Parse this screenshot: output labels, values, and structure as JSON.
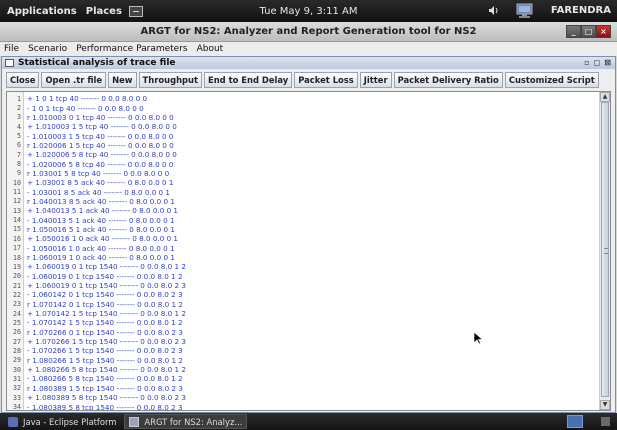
{
  "top_panel": {
    "applications": "Applications",
    "places": "Places",
    "clock": "Tue May  9,  3:11 AM",
    "user": "FARENDRA"
  },
  "window": {
    "title": "ARGT for NS2: Analyzer and Report Generation tool for NS2"
  },
  "menubar": {
    "file": "File",
    "scenario": "Scenario",
    "performance": "Performance Parameters",
    "about": "About"
  },
  "frame": {
    "title": "Statistical analysis of trace file",
    "buttons": [
      "Close",
      "Open .tr file",
      "New",
      "Throughput",
      "End to End Delay",
      "Packet Loss",
      "Jitter",
      "Packet Delivery Ratio",
      "Customized Script"
    ]
  },
  "trace_lines": [
    "+ 1 0 1 tcp 40 ------- 0 0.0 8.0 0 0",
    "- 1 0 1 tcp 40 ------- 0 0.0 8.0 0 0",
    "r 1.010003 0 1 tcp 40 ------- 0 0.0 8.0 0 0",
    "+ 1.010003 1 5 tcp 40 ------- 0 0.0 8.0 0 0",
    "- 1.010003 1 5 tcp 40 ------- 0 0.0 8.0 0 0",
    "r 1.020006 1 5 tcp 40 ------- 0 0.0 8.0 0 0",
    "+ 1.020006 5 8 tcp 40 ------- 0 0.0 8.0 0 0",
    "- 1.020006 5 8 tcp 40 ------- 0 0.0 8.0 0 0",
    "r 1.03001 5 8 tcp 40 ------- 0 0.0 8.0 0 0",
    "+ 1.03001 8 5 ack 40 ------- 0 8.0 0.0 0 1",
    "- 1.03001 8 5 ack 40 ------- 0 8.0 0.0 0 1",
    "r 1.040013 8 5 ack 40 ------- 0 8.0 0.0 0 1",
    "+ 1.040013 5 1 ack 40 ------- 0 8.0 0.0 0 1",
    "- 1.040013 5 1 ack 40 ------- 0 8.0 0.0 0 1",
    "r 1.050016 5 1 ack 40 ------- 0 8.0 0.0 0 1",
    "+ 1.050016 1 0 ack 40 ------- 0 8.0 0.0 0 1",
    "- 1.050016 1 0 ack 40 ------- 0 8.0 0.0 0 1",
    "r 1.060019 1 0 ack 40 ------- 0 8.0 0.0 0 1",
    "+ 1.060019 0 1 tcp 1540 ------- 0 0.0 8.0 1 2",
    "- 1.060019 0 1 tcp 1540 ------- 0 0.0 8.0 1 2",
    "+ 1.060019 0 1 tcp 1540 ------- 0 0.0 8.0 2 3",
    "- 1.060142 0 1 tcp 1540 ------- 0 0.0 8.0 2 3",
    "r 1.070142 0 1 tcp 1540 ------- 0 0.0 8.0 1 2",
    "+ 1.070142 1 5 tcp 1540 ------- 0 0.0 8.0 1 2",
    "- 1.070142 1 5 tcp 1540 ------- 0 0.0 8.0 1 2",
    "r 1.070266 0 1 tcp 1540 ------- 0 0.0 8.0 2 3",
    "+ 1.070266 1 5 tcp 1540 ------- 0 0.0 8.0 2 3",
    "- 1.070266 1 5 tcp 1540 ------- 0 0.0 8.0 2 3",
    "r 1.080266 1 5 tcp 1540 ------- 0 0.0 8.0 1 2",
    "+ 1.080266 5 8 tcp 1540 ------- 0 0.0 8.0 1 2",
    "- 1.080266 5 8 tcp 1540 ------- 0 0.0 8.0 1 2",
    "r 1.080389 1 5 tcp 1540 ------- 0 0.0 8.0 2 3",
    "+ 1.080389 5 8 tcp 1540 ------- 0 0.0 8.0 2 3",
    "- 1.080389 5 8 tcp 1540 ------- 0 0.0 8.0 2 3"
  ],
  "taskbar": {
    "task1": "Java - Eclipse Platform",
    "task2": "ARGT for NS2: Analyz..."
  }
}
